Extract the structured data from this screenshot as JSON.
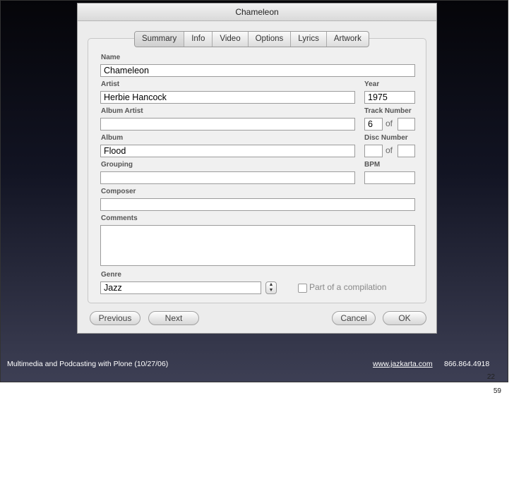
{
  "window": {
    "title": "Chameleon"
  },
  "tabs": [
    "Summary",
    "Info",
    "Video",
    "Options",
    "Lyrics",
    "Artwork"
  ],
  "form": {
    "name_label": "Name",
    "name": "Chameleon",
    "artist_label": "Artist",
    "artist": "Herbie Hancock",
    "year_label": "Year",
    "year": "1975",
    "album_artist_label": "Album Artist",
    "album_artist": "",
    "track_number_label": "Track Number",
    "track_number": "6",
    "track_total": "",
    "album_label": "Album",
    "album": "Flood",
    "disc_number_label": "Disc Number",
    "disc_number": "",
    "disc_total": "",
    "of_label": "of",
    "grouping_label": "Grouping",
    "grouping": "",
    "bpm_label": "BPM",
    "bpm": "",
    "composer_label": "Composer",
    "composer": "",
    "comments_label": "Comments",
    "comments": "",
    "genre_label": "Genre",
    "genre": "Jazz",
    "compilation_label": "Part of a compilation"
  },
  "buttons": {
    "previous": "Previous",
    "next": "Next",
    "cancel": "Cancel",
    "ok": "OK"
  },
  "footer": {
    "left": "Multimedia and Podcasting with Plone (10/27/06)",
    "link": "www.jazkarta.com",
    "phone": "866.864.4918"
  },
  "pages": {
    "slide": "22",
    "total": "59"
  }
}
